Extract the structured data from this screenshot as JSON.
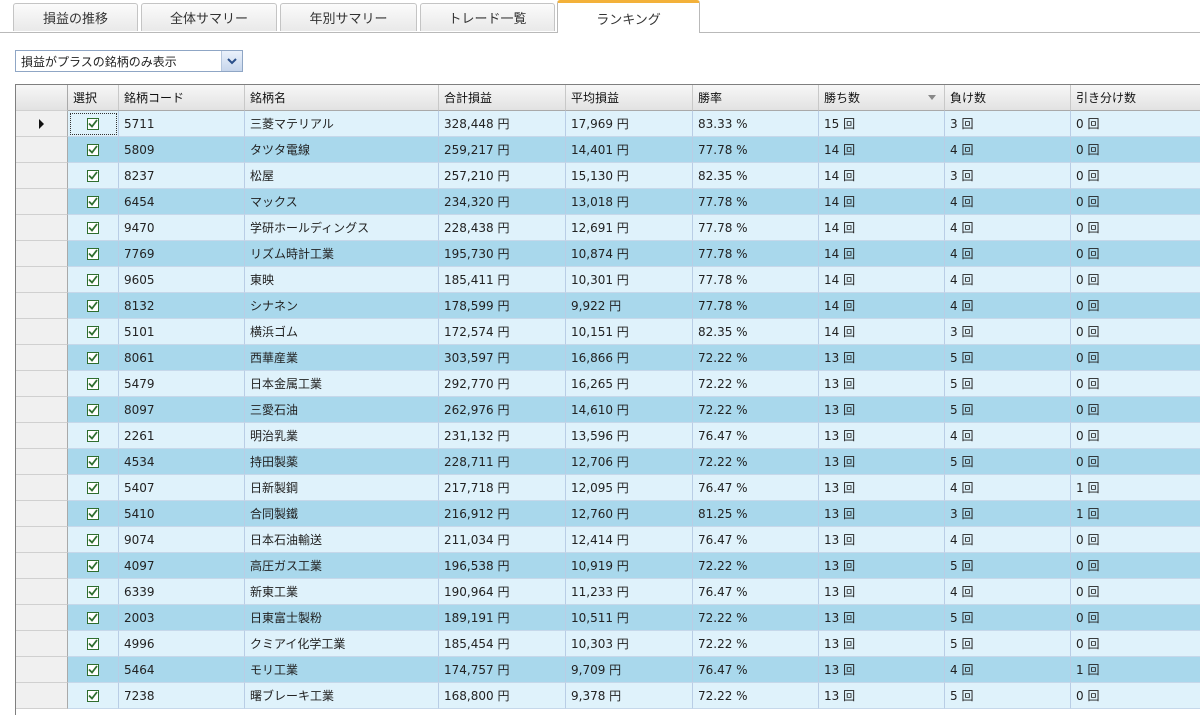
{
  "tabs": [
    "損益の推移",
    "全体サマリー",
    "年別サマリー",
    "トレード一覧",
    "ランキング"
  ],
  "filter": {
    "value": "損益がプラスの銘柄のみ表示"
  },
  "grid": {
    "headers": [
      "選択",
      "銘柄コード",
      "銘柄名",
      "合計損益",
      "平均損益",
      "勝率",
      "勝ち数",
      "負け数",
      "引き分け数"
    ],
    "sort_column": "勝ち数",
    "rows": [
      {
        "code": "5711",
        "name": "三菱マテリアル",
        "total": "328,448 円",
        "avg": "17,969 円",
        "rate": "83.33 %",
        "win": "15 回",
        "lose": "3 回",
        "draw": "0 回"
      },
      {
        "code": "5809",
        "name": "タツタ電線",
        "total": "259,217 円",
        "avg": "14,401 円",
        "rate": "77.78 %",
        "win": "14 回",
        "lose": "4 回",
        "draw": "0 回"
      },
      {
        "code": "8237",
        "name": "松屋",
        "total": "257,210 円",
        "avg": "15,130 円",
        "rate": "82.35 %",
        "win": "14 回",
        "lose": "3 回",
        "draw": "0 回"
      },
      {
        "code": "6454",
        "name": "マックス",
        "total": "234,320 円",
        "avg": "13,018 円",
        "rate": "77.78 %",
        "win": "14 回",
        "lose": "4 回",
        "draw": "0 回"
      },
      {
        "code": "9470",
        "name": "学研ホールディングス",
        "total": "228,438 円",
        "avg": "12,691 円",
        "rate": "77.78 %",
        "win": "14 回",
        "lose": "4 回",
        "draw": "0 回"
      },
      {
        "code": "7769",
        "name": "リズム時計工業",
        "total": "195,730 円",
        "avg": "10,874 円",
        "rate": "77.78 %",
        "win": "14 回",
        "lose": "4 回",
        "draw": "0 回"
      },
      {
        "code": "9605",
        "name": "東映",
        "total": "185,411 円",
        "avg": "10,301 円",
        "rate": "77.78 %",
        "win": "14 回",
        "lose": "4 回",
        "draw": "0 回"
      },
      {
        "code": "8132",
        "name": "シナネン",
        "total": "178,599 円",
        "avg": "9,922 円",
        "rate": "77.78 %",
        "win": "14 回",
        "lose": "4 回",
        "draw": "0 回"
      },
      {
        "code": "5101",
        "name": "横浜ゴム",
        "total": "172,574 円",
        "avg": "10,151 円",
        "rate": "82.35 %",
        "win": "14 回",
        "lose": "3 回",
        "draw": "0 回"
      },
      {
        "code": "8061",
        "name": "西華産業",
        "total": "303,597 円",
        "avg": "16,866 円",
        "rate": "72.22 %",
        "win": "13 回",
        "lose": "5 回",
        "draw": "0 回"
      },
      {
        "code": "5479",
        "name": "日本金属工業",
        "total": "292,770 円",
        "avg": "16,265 円",
        "rate": "72.22 %",
        "win": "13 回",
        "lose": "5 回",
        "draw": "0 回"
      },
      {
        "code": "8097",
        "name": "三愛石油",
        "total": "262,976 円",
        "avg": "14,610 円",
        "rate": "72.22 %",
        "win": "13 回",
        "lose": "5 回",
        "draw": "0 回"
      },
      {
        "code": "2261",
        "name": "明治乳業",
        "total": "231,132 円",
        "avg": "13,596 円",
        "rate": "76.47 %",
        "win": "13 回",
        "lose": "4 回",
        "draw": "0 回"
      },
      {
        "code": "4534",
        "name": "持田製薬",
        "total": "228,711 円",
        "avg": "12,706 円",
        "rate": "72.22 %",
        "win": "13 回",
        "lose": "5 回",
        "draw": "0 回"
      },
      {
        "code": "5407",
        "name": "日新製鋼",
        "total": "217,718 円",
        "avg": "12,095 円",
        "rate": "76.47 %",
        "win": "13 回",
        "lose": "4 回",
        "draw": "1 回"
      },
      {
        "code": "5410",
        "name": "合同製鐵",
        "total": "216,912 円",
        "avg": "12,760 円",
        "rate": "81.25 %",
        "win": "13 回",
        "lose": "3 回",
        "draw": "1 回"
      },
      {
        "code": "9074",
        "name": "日本石油輸送",
        "total": "211,034 円",
        "avg": "12,414 円",
        "rate": "76.47 %",
        "win": "13 回",
        "lose": "4 回",
        "draw": "0 回"
      },
      {
        "code": "4097",
        "name": "高圧ガス工業",
        "total": "196,538 円",
        "avg": "10,919 円",
        "rate": "72.22 %",
        "win": "13 回",
        "lose": "5 回",
        "draw": "0 回"
      },
      {
        "code": "6339",
        "name": "新東工業",
        "total": "190,964 円",
        "avg": "11,233 円",
        "rate": "76.47 %",
        "win": "13 回",
        "lose": "4 回",
        "draw": "0 回"
      },
      {
        "code": "2003",
        "name": "日東富士製粉",
        "total": "189,191 円",
        "avg": "10,511 円",
        "rate": "72.22 %",
        "win": "13 回",
        "lose": "5 回",
        "draw": "0 回"
      },
      {
        "code": "4996",
        "name": "クミアイ化学工業",
        "total": "185,454 円",
        "avg": "10,303 円",
        "rate": "72.22 %",
        "win": "13 回",
        "lose": "5 回",
        "draw": "0 回"
      },
      {
        "code": "5464",
        "name": "モリ工業",
        "total": "174,757 円",
        "avg": "9,709 円",
        "rate": "76.47 %",
        "win": "13 回",
        "lose": "4 回",
        "draw": "1 回"
      },
      {
        "code": "7238",
        "name": "曙ブレーキ工業",
        "total": "168,800 円",
        "avg": "9,378 円",
        "rate": "72.22 %",
        "win": "13 回",
        "lose": "5 回",
        "draw": "0 回"
      }
    ]
  },
  "colors": {
    "row_light": "#dff2fb",
    "row_dark": "#a9d8ec",
    "active_tab_accent": "#f3b13a",
    "checkbox": "#2f6e2f"
  },
  "icons": {
    "row_pointer": "current-row-pointer-icon",
    "check": "checkmark-icon",
    "dropdown": "chevron-down-icon",
    "sort": "sort-descending-icon"
  }
}
